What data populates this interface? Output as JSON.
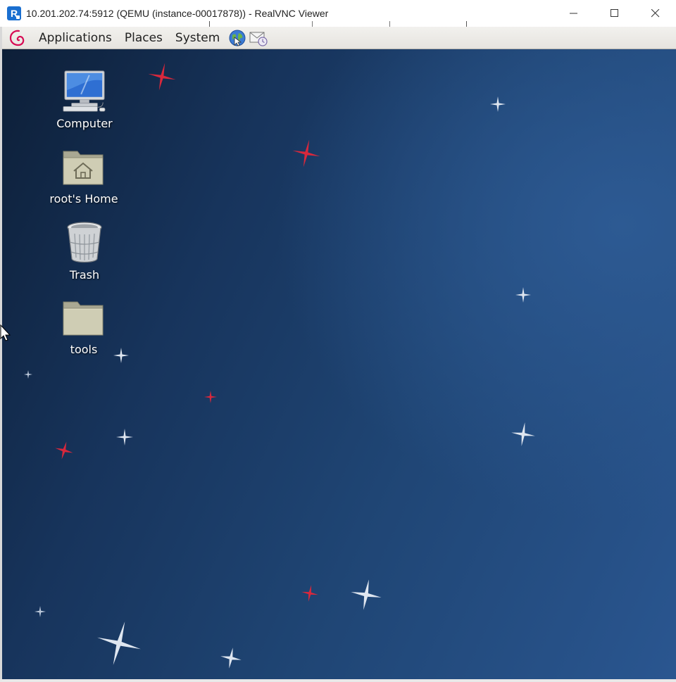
{
  "window": {
    "title": "10.201.202.74:5912 (QEMU (instance-00017878)) - RealVNC Viewer",
    "app_icon_letter": "R"
  },
  "panel": {
    "menus": [
      {
        "label": "Applications"
      },
      {
        "label": "Places"
      },
      {
        "label": "System"
      }
    ],
    "launchers": [
      {
        "icon": "web-browser-icon"
      },
      {
        "icon": "mail-client-icon"
      }
    ]
  },
  "desktop": {
    "icons": [
      {
        "label": "Computer",
        "icon": "computer-icon"
      },
      {
        "label": "root's Home",
        "icon": "home-folder-icon"
      },
      {
        "label": "Trash",
        "icon": "trash-icon"
      },
      {
        "label": "tools",
        "icon": "folder-icon"
      }
    ]
  },
  "colors": {
    "desktop_dark": "#0d1f38",
    "desktop_light": "#2a5690",
    "star_red": "#d8283c",
    "star_white": "#dfe6f0",
    "panel_bg": "#eeede9",
    "debian_red": "#d70a53"
  }
}
